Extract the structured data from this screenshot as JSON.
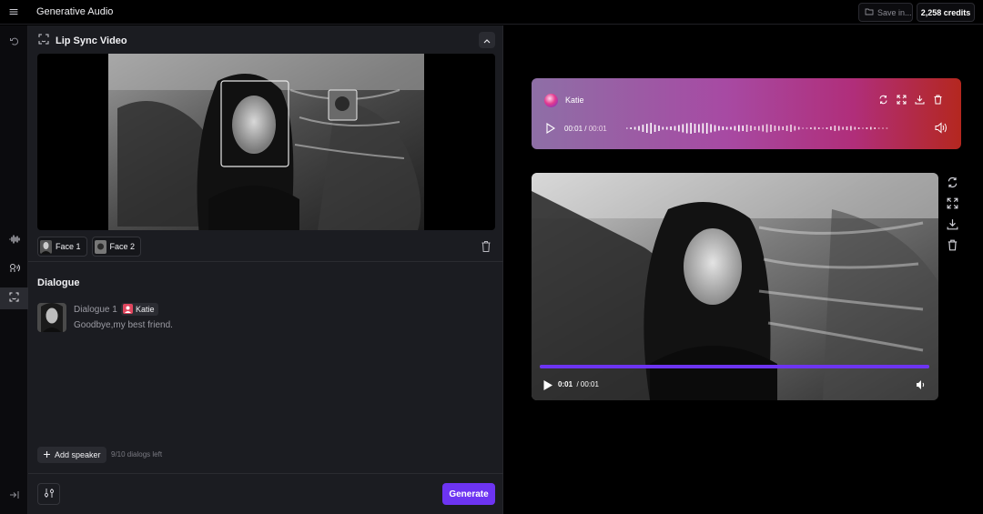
{
  "app": {
    "title": "Generative Audio",
    "save_label": "Save in...",
    "credits": "2,258 credits"
  },
  "rail": {
    "items": [
      {
        "icon": "undo-icon"
      },
      {
        "icon": "waveform-icon"
      },
      {
        "icon": "voice-icon"
      },
      {
        "icon": "face-scan-icon",
        "active": true
      },
      {
        "icon": "collapse-panel-icon"
      }
    ]
  },
  "panel": {
    "title": "Lip Sync Video",
    "faces": [
      {
        "label": "Face 1"
      },
      {
        "label": "Face 2"
      }
    ],
    "dialogue": {
      "heading": "Dialogue",
      "items": [
        {
          "label": "Dialogue 1",
          "speaker": "Katie",
          "text": "Goodbye,my best friend."
        }
      ],
      "add_speaker_label": "Add speaker",
      "dialogs_left": "9/10 dialogs left"
    },
    "generate_label": "Generate"
  },
  "audio": {
    "speaker": "Katie",
    "current_time": "00:01",
    "separator": " / ",
    "duration": "00:01",
    "accent": "#6d34f2"
  },
  "video": {
    "current_time": "0:01",
    "duration": "/ 00:01",
    "progress": 1.0
  },
  "colors": {
    "accent": "#6d34f2",
    "panel": "#1b1c21",
    "background": "#000000"
  }
}
